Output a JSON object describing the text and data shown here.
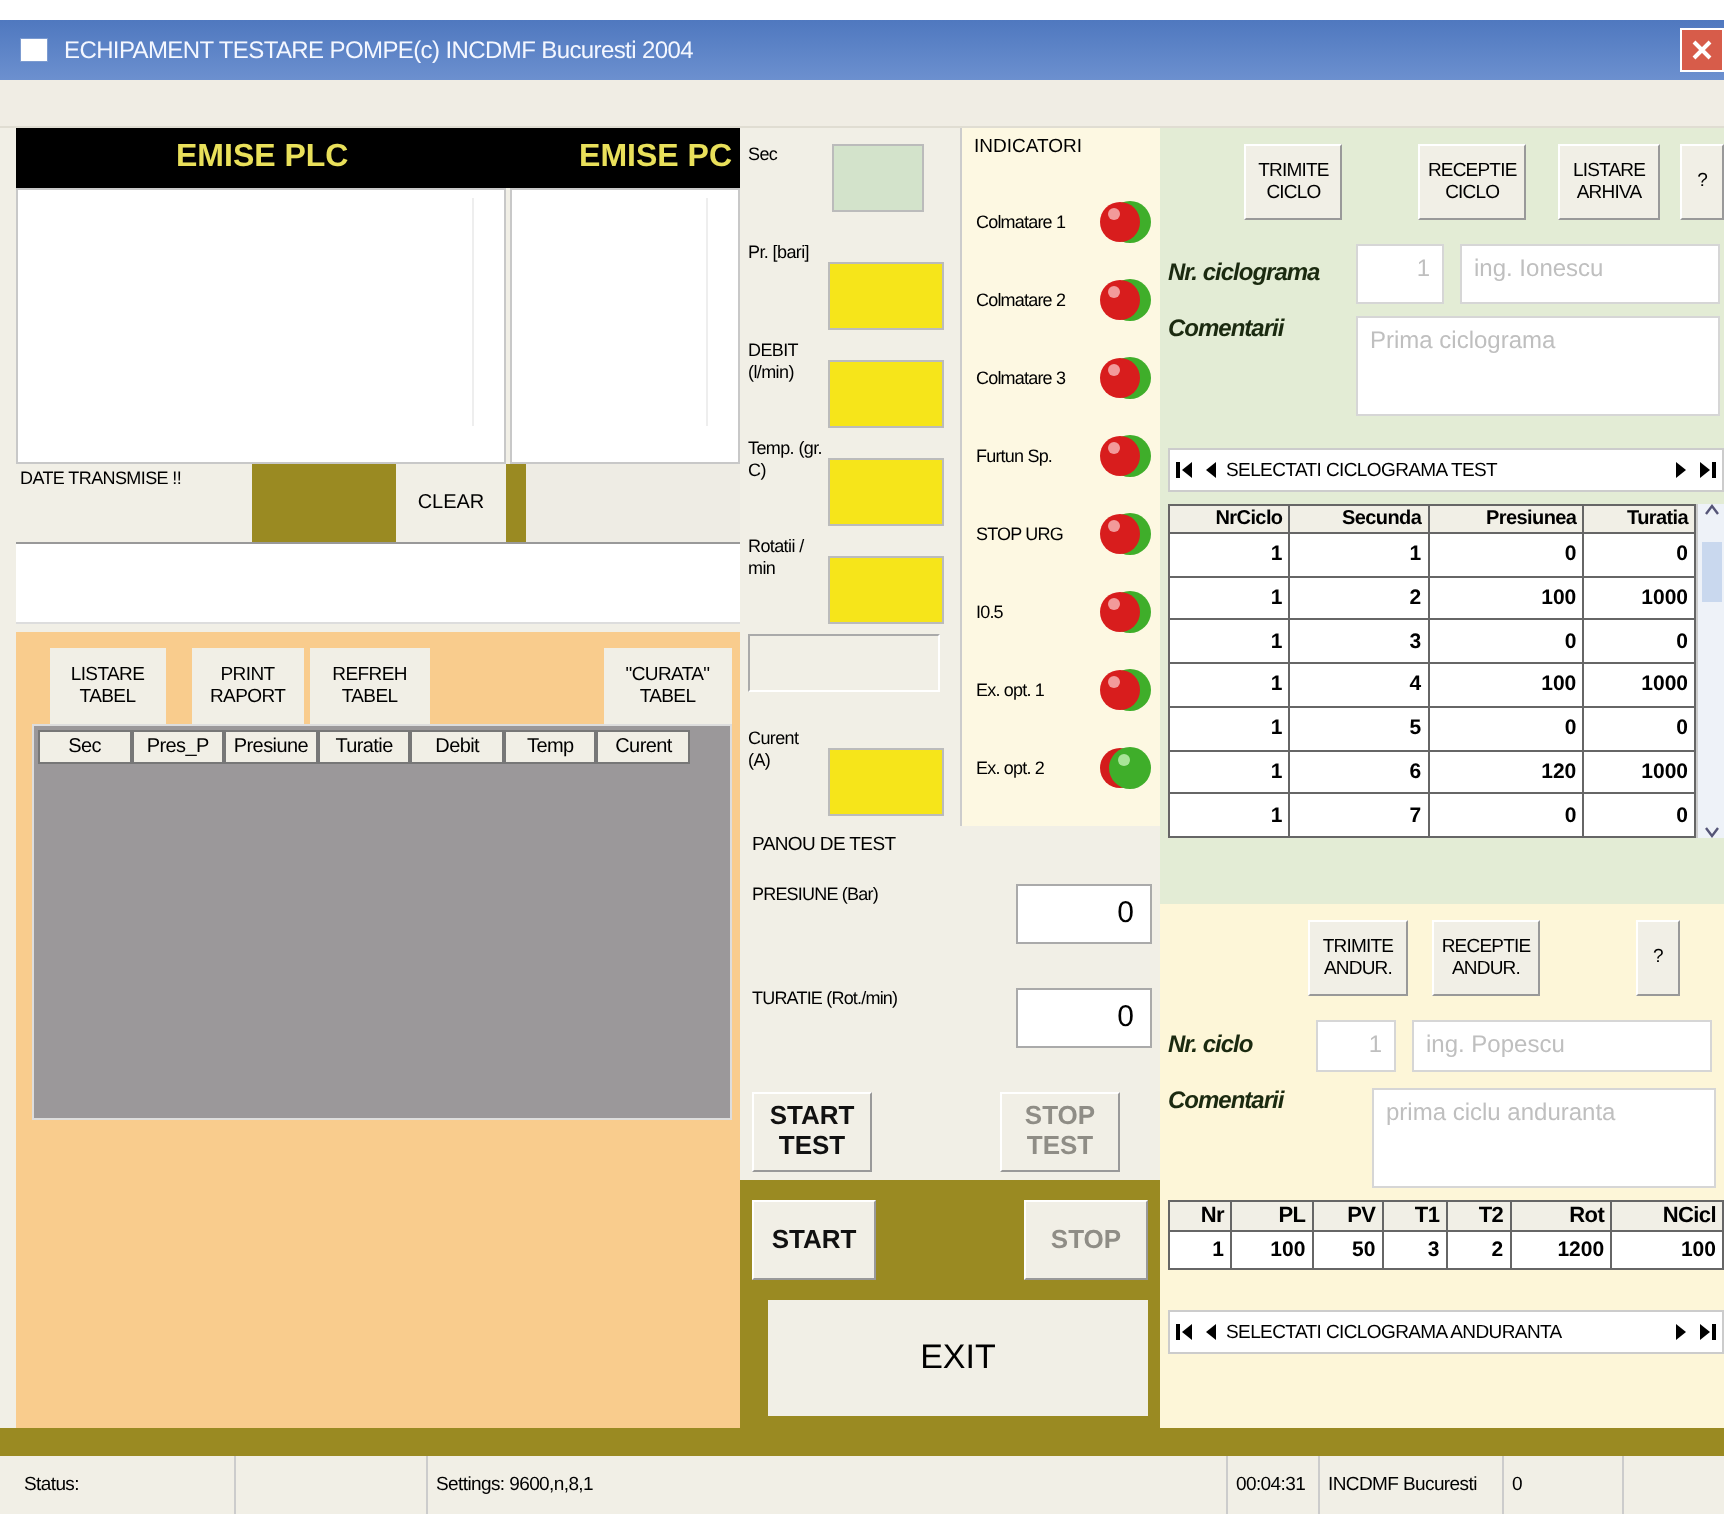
{
  "window": {
    "title": "ECHIPAMENT TESTARE POMPE(c) INCDMF Bucuresti 2004"
  },
  "emise": {
    "plc_label": "EMISE PLC",
    "pc_label": "EMISE PC"
  },
  "transmit": {
    "label": "DATE TRANSMISE !!",
    "clear_button": "CLEAR"
  },
  "log_buttons": [
    "LISTARE TABEL",
    "PRINT RAPORT",
    "REFREH TABEL",
    "\"CURATA\" TABEL"
  ],
  "log_table": {
    "columns": [
      "Sec",
      "Pres_P",
      "Presiune",
      "Turatie",
      "Debit",
      "Temp",
      "Curent"
    ]
  },
  "measurements": [
    {
      "kind": "green",
      "label": "Sec"
    },
    {
      "kind": "yellow",
      "label": "Pr. [bari]"
    },
    {
      "kind": "yellow",
      "label": "DEBIT (l/min)"
    },
    {
      "kind": "yellow",
      "label": "Temp. (gr. C)"
    },
    {
      "kind": "yellow",
      "label": "Rotatii / min"
    },
    {
      "kind": "empty"
    },
    {
      "kind": "yellow",
      "label": "Curent (A)"
    }
  ],
  "indicators": {
    "title": "INDICATORI",
    "items": [
      {
        "label": "Colmatare 1",
        "on": false
      },
      {
        "label": "Colmatare 2",
        "on": false
      },
      {
        "label": "Colmatare 3",
        "on": false
      },
      {
        "label": "Furtun Sp.",
        "on": false
      },
      {
        "label": "STOP URG",
        "on": false
      },
      {
        "label": "I0.5",
        "on": false
      },
      {
        "label": "Ex. opt. 1",
        "on": false
      },
      {
        "label": "Ex. opt. 2",
        "on": true
      }
    ]
  },
  "test_panel": {
    "title": "PANOU DE TEST",
    "fields": [
      {
        "label": "PRESIUNE (Bar)",
        "value": "0"
      },
      {
        "label": "TURATIE (Rot./min)",
        "value": "0"
      }
    ],
    "buttons": [
      {
        "label": "START TEST",
        "disabled": false
      },
      {
        "label": "STOP TEST",
        "disabled": true
      }
    ]
  },
  "control": {
    "buttons": [
      {
        "label": "START",
        "disabled": false
      },
      {
        "label": "STOP",
        "disabled": true
      }
    ],
    "exit": "EXIT"
  },
  "cycle_panel": {
    "buttons": [
      "TRIMITE CICLO",
      "RECEPTIE CICLO",
      "LISTARE ARHIVA",
      "?"
    ],
    "number_label": "Nr. ciclograma",
    "number": "1",
    "author": "ing. Ionescu",
    "comments_label": "Comentarii",
    "comments": "Prima ciclograma",
    "navigator": "SELECTATI CICLOGRAMA TEST",
    "table": {
      "columns": [
        "NrCiclo",
        "Secunda",
        "Presiunea",
        "Turatia"
      ],
      "rows": [
        [
          "1",
          "1",
          "0",
          "0"
        ],
        [
          "1",
          "2",
          "100",
          "1000"
        ],
        [
          "1",
          "3",
          "0",
          "0"
        ],
        [
          "1",
          "4",
          "100",
          "1000"
        ],
        [
          "1",
          "5",
          "0",
          "0"
        ],
        [
          "1",
          "6",
          "120",
          "1000"
        ],
        [
          "1",
          "7",
          "0",
          "0"
        ]
      ]
    }
  },
  "endurance_panel": {
    "buttons": [
      "TRIMITE ANDUR.",
      "RECEPTIE ANDUR.",
      "?"
    ],
    "number_label": "Nr. ciclo",
    "number": "1",
    "author": "ing. Popescu",
    "comments_label": "Comentarii",
    "comments": "prima ciclu anduranta",
    "navigator": "SELECTATI CICLOGRAMA ANDURANTA",
    "table": {
      "columns": [
        "Nr",
        "PL",
        "PV",
        "T1",
        "T2",
        "Rot",
        "NCicl"
      ],
      "rows": [
        [
          "1",
          "100",
          "50",
          "3",
          "2",
          "1200",
          "100"
        ]
      ]
    }
  },
  "status_bar": {
    "status": "Status:",
    "settings": "Settings: 9600,n,8,1",
    "time": "00:04:31",
    "place": "INCDMF Bucuresti",
    "count": "0"
  }
}
